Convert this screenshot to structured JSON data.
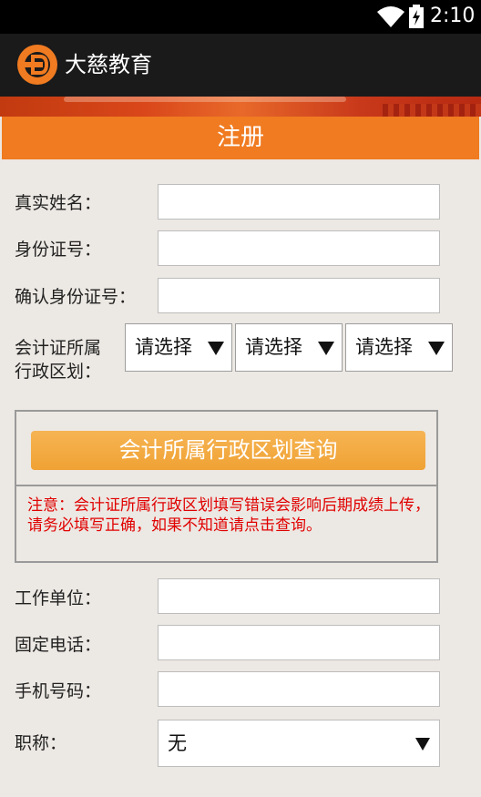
{
  "status_bar": {
    "time": "2:10",
    "icons": [
      "wifi-icon",
      "battery-charging-icon"
    ]
  },
  "app": {
    "title": "大慈教育",
    "logo_icon": "dc-logo-icon"
  },
  "page": {
    "title": "注册"
  },
  "form": {
    "real_name_label": "真实姓名：",
    "id_number_label": "身份证号：",
    "confirm_id_label": "确认身份证号：",
    "region_label_line1": "会计证所属",
    "region_label_line2": "行政区划：",
    "region_selects": [
      "请选择",
      "请选择",
      "请选择"
    ],
    "query_button": "会计所属行政区划查询",
    "notice": "注意：会计证所属行政区划填写错误会影响后期成绩上传，请务必填写正确，如果不知道请点击查询。",
    "work_unit_label": "工作单位：",
    "landline_label": "固定电话：",
    "mobile_label": "手机号码：",
    "title_label": "职称：",
    "title_value": "无"
  },
  "colors": {
    "accent": "#f07b21",
    "notice": "#e00000",
    "button": "#f0a234"
  }
}
